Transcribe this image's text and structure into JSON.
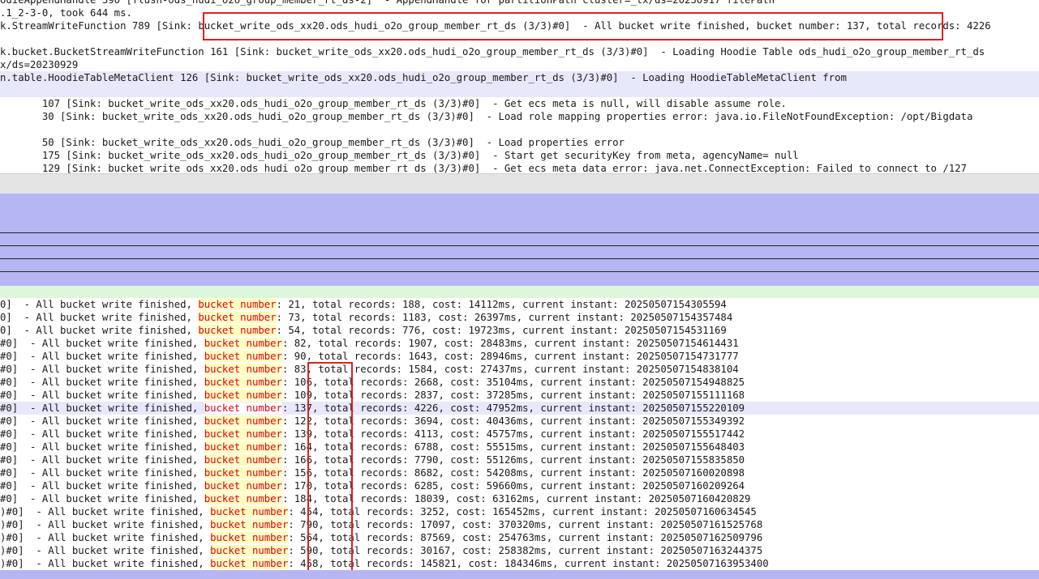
{
  "colors": {
    "highlight_row": "#e8e8fb",
    "keyword_bg": "#ffffc0",
    "keyword_fg": "#e0001b",
    "annotation_box": "#e02020",
    "pane_blue": "#b6b6f5",
    "pane_green": "#ddf7dd"
  },
  "search_keyword": "bucket number",
  "top_log": {
    "lines": [
      {
        "text": "odieAppendHandle 390 [flush-ods_hudi_o2o_group_member_rt_ds-2]  - AppendHandle for partitionPath cluster=_tx/ds=20230917 filePath"
      },
      {
        "text": ".1_2-3-0, took 644 ms."
      },
      {
        "pre": "k.StreamWriteFunction 789 [Sink:",
        "boxed": " bucket_write_ods_xx20.ods_hudi_o2o_group_member_rt_ds (3/3)#0]  - All bucket write finished, bucket number: 137,",
        "post": " total records: 4226"
      },
      {
        "text": ""
      },
      {
        "text": "k.bucket.BucketStreamWriteFunction 161 [Sink: bucket_write_ods_xx20.ods_hudi_o2o_group_member_rt_ds (3/3)#0]  - Loading Hoodie Table ods_hudi_o2o_group_member_rt_ds"
      },
      {
        "text": "x/ds=20230929"
      },
      {
        "text": "n.table.HoodieTableMetaClient 126 [Sink: bucket_write_ods_xx20.ods_hudi_o2o_group_member_rt_ds (3/3)#0]  - Loading HoodieTableMetaClient from"
      },
      {
        "text": ""
      },
      {
        "text": "       107 [Sink: bucket_write_ods_xx20.ods_hudi_o2o_group_member_rt_ds (3/3)#0]  - Get ecs meta is null, will disable assume role."
      },
      {
        "text": "       30 [Sink: bucket_write_ods_xx20.ods_hudi_o2o_group_member_rt_ds (3/3)#0]  - Load role mapping properties error: java.io.FileNotFoundException: /opt/Bigdata"
      },
      {
        "text": ""
      },
      {
        "text": "       50 [Sink: bucket_write_ods_xx20.ods_hudi_o2o_group_member_rt_ds (3/3)#0]  - Load properties error"
      },
      {
        "text": "       175 [Sink: bucket_write_ods_xx20.ods_hudi_o2o_group_member_rt_ds (3/3)#0]  - Start get securityKey from meta, agencyName= null"
      },
      {
        "text": "       129 [Sink: bucket_write_ods_xx20.ods_hudi_o2o_group_member_rt_ds (3/3)#0]  - Get ecs meta data error: java.net.ConnectException: Failed to connect to /127"
      }
    ]
  },
  "bottom_log": {
    "rows": [
      {
        "prefix": "0]  - All bucket write finished, ",
        "suffix": ": 21, total records: 188, cost: 14112ms, current instant: 20250507154305594"
      },
      {
        "prefix": "0]  - All bucket write finished, ",
        "suffix": ": 73, total records: 1183, cost: 26397ms, current instant: 20250507154357484"
      },
      {
        "prefix": "0]  - All bucket write finished, ",
        "suffix": ": 54, total records: 776, cost: 19723ms, current instant: 20250507154531169"
      },
      {
        "prefix": "#0]  - All bucket write finished, ",
        "suffix": ": 82, total records: 1907, cost: 28483ms, current instant: 20250507154614431"
      },
      {
        "prefix": "#0]  - All bucket write finished, ",
        "suffix": ": 90, total records: 1643, cost: 28946ms, current instant: 20250507154731777"
      },
      {
        "prefix": "#0]  - All bucket write finished, ",
        "suffix": ": 83, total records: 1584, cost: 27437ms, current instant: 20250507154838104"
      },
      {
        "prefix": "#0]  - All bucket write finished, ",
        "suffix": ": 106, total records: 2668, cost: 35104ms, current instant: 20250507154948825"
      },
      {
        "prefix": "#0]  - All bucket write finished, ",
        "suffix": ": 109, total records: 2837, cost: 37285ms, current instant: 20250507155111168"
      },
      {
        "prefix": "#0]  - All bucket write finished, ",
        "suffix": ": 137, total records: 4226, cost: 47952ms, current instant: 20250507155220109",
        "selected": true
      },
      {
        "prefix": "#0]  - All bucket write finished, ",
        "suffix": ": 122, total records: 3694, cost: 40436ms, current instant: 20250507155349392"
      },
      {
        "prefix": "#0]  - All bucket write finished, ",
        "suffix": ": 139, total records: 4113, cost: 45757ms, current instant: 20250507155517442"
      },
      {
        "prefix": "#0]  - All bucket write finished, ",
        "suffix": ": 164, total records: 6788, cost: 55515ms, current instant: 20250507155648403"
      },
      {
        "prefix": "#0]  - All bucket write finished, ",
        "suffix": ": 166, total records: 7790, cost: 55126ms, current instant: 20250507155835850"
      },
      {
        "prefix": "#0]  - All bucket write finished, ",
        "suffix": ": 156, total records: 8682, cost: 54208ms, current instant: 20250507160020898"
      },
      {
        "prefix": "#0]  - All bucket write finished, ",
        "suffix": ": 170, total records: 6285, cost: 59660ms, current instant: 20250507160209264"
      },
      {
        "prefix": "#0]  - All bucket write finished, ",
        "suffix": ": 184, total records: 18039, cost: 63162ms, current instant: 20250507160420829"
      },
      {
        "prefix": ")#0]  - All bucket write finished, ",
        "suffix": ": 454, total records: 3252, cost: 165452ms, current instant: 20250507160634545"
      },
      {
        "prefix": ")#0]  - All bucket write finished, ",
        "suffix": ": 790, total records: 17097, cost: 370320ms, current instant: 20250507161525768"
      },
      {
        "prefix": ")#0]  - All bucket write finished, ",
        "suffix": ": 564, total records: 87569, cost: 254763ms, current instant: 20250507162509796"
      },
      {
        "prefix": ")#0]  - All bucket write finished, ",
        "suffix": ": 590, total records: 30167, cost: 258382ms, current instant: 20250507163244375"
      },
      {
        "prefix": ")#0]  - All bucket write finished, ",
        "suffix": ": 458, total records: 145821, cost: 184346ms, current instant: 20250507163953400"
      }
    ]
  }
}
